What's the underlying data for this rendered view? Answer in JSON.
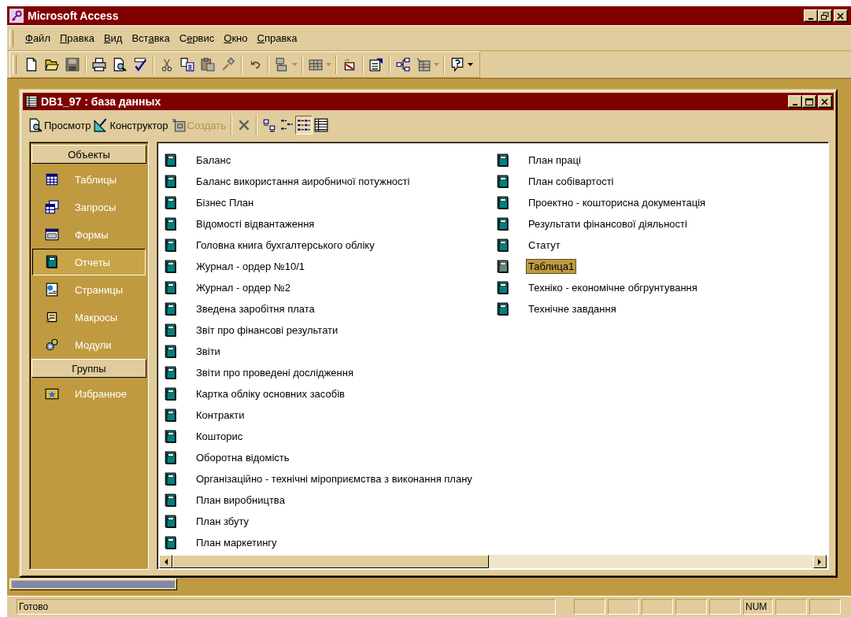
{
  "window": {
    "title": "Microsoft Access",
    "controls": [
      {
        "kind": "minimize"
      },
      {
        "kind": "restore"
      },
      {
        "kind": "close"
      }
    ]
  },
  "menu": [
    {
      "key": "Ф",
      "after": "айл"
    },
    {
      "key": "П",
      "after": "равка"
    },
    {
      "key": "В",
      "after": "ид"
    },
    {
      "before": "Вст",
      "key": "а",
      "after": "вка"
    },
    {
      "before": "С",
      "key": "е",
      "after": "рвис"
    },
    {
      "key": "О",
      "after": "кно"
    },
    {
      "key": "С",
      "after": "правка"
    }
  ],
  "toolbar": [
    {
      "kind": "new",
      "disabled": false
    },
    {
      "kind": "open",
      "disabled": false
    },
    {
      "kind": "save",
      "disabled": true
    },
    {
      "kind": "separator"
    },
    {
      "kind": "print",
      "disabled": false
    },
    {
      "kind": "preview",
      "disabled": false
    },
    {
      "kind": "spelling",
      "disabled": false
    },
    {
      "kind": "separator"
    },
    {
      "kind": "cut",
      "disabled": true
    },
    {
      "kind": "copy",
      "disabled": false
    },
    {
      "kind": "paste",
      "disabled": true
    },
    {
      "kind": "format_painter",
      "disabled": true
    },
    {
      "kind": "separator"
    },
    {
      "kind": "undo",
      "disabled": true
    },
    {
      "kind": "separator"
    },
    {
      "kind": "office_links",
      "disabled": true,
      "dropdown": true
    },
    {
      "kind": "separator"
    },
    {
      "kind": "analyze",
      "disabled": true,
      "dropdown": true
    },
    {
      "kind": "separator"
    },
    {
      "kind": "code",
      "disabled": false
    },
    {
      "kind": "separator"
    },
    {
      "kind": "properties",
      "disabled": false
    },
    {
      "kind": "separator"
    },
    {
      "kind": "relationships",
      "disabled": false
    },
    {
      "kind": "new_object",
      "disabled": true,
      "dropdown": true
    },
    {
      "kind": "separator"
    },
    {
      "kind": "help",
      "disabled": false,
      "dropdown": true
    }
  ],
  "database_window": {
    "title": "DB1_97 : база данных",
    "controls": [
      {
        "kind": "minimize"
      },
      {
        "kind": "maximize"
      },
      {
        "kind": "close"
      }
    ],
    "toolbar": [
      {
        "kind": "preview",
        "label": "Просмотр",
        "disabled": false
      },
      {
        "kind": "design",
        "label": "Конструктор",
        "disabled": false
      },
      {
        "kind": "create",
        "label": "Создать",
        "disabled": true
      },
      {
        "kind": "separator"
      },
      {
        "kind": "delete",
        "disabled": true
      },
      {
        "kind": "separator"
      },
      {
        "kind": "large_icons",
        "selected": false
      },
      {
        "kind": "small_icons",
        "selected": false
      },
      {
        "kind": "list",
        "selected": true
      },
      {
        "kind": "details",
        "selected": false
      }
    ],
    "sidebar": [
      {
        "header": "Объекты",
        "items": [
          {
            "kind": "tables",
            "label": "Таблицы",
            "selected": false
          },
          {
            "kind": "queries",
            "label": "Запросы",
            "selected": false
          },
          {
            "kind": "forms",
            "label": "Формы",
            "selected": false
          },
          {
            "kind": "reports",
            "label": "Отчеты",
            "selected": true
          },
          {
            "kind": "pages",
            "label": "Страницы",
            "selected": false
          },
          {
            "kind": "macros",
            "label": "Макросы",
            "selected": false
          },
          {
            "kind": "modules",
            "label": "Модули",
            "selected": false
          }
        ]
      },
      {
        "header": "Группы",
        "items": [
          {
            "kind": "favorites",
            "label": "Избранное",
            "selected": false
          }
        ]
      }
    ],
    "objects": {
      "columns": [
        {
          "items": [
            {
              "label": "Баланс",
              "selected": false
            },
            {
              "label": "Баланс використання аиробничої потужності",
              "selected": false
            },
            {
              "label": "Бізнес План",
              "selected": false
            },
            {
              "label": "Відомості відвантаження",
              "selected": false
            },
            {
              "label": "Головна книга бухгалтерського обліку",
              "selected": false
            },
            {
              "label": "Журнал - ордер №10/1",
              "selected": false
            },
            {
              "label": "Журнал - ордер №2",
              "selected": false
            },
            {
              "label": "Зведена заробітня плата",
              "selected": false
            },
            {
              "label": "Звіт про фінансові результати",
              "selected": false
            },
            {
              "label": "Звіти",
              "selected": false
            },
            {
              "label": "Звіти про проведені дослідження",
              "selected": false
            },
            {
              "label": "Картка обліку основних засобів",
              "selected": false
            },
            {
              "label": "Контракти",
              "selected": false
            },
            {
              "label": "Кошторис",
              "selected": false
            },
            {
              "label": "Оборотна відомість",
              "selected": false
            },
            {
              "label": "Організаційно - технічні міроприємства з виконання плану",
              "selected": false
            },
            {
              "label": "План виробництва",
              "selected": false
            },
            {
              "label": "План збуту",
              "selected": false
            },
            {
              "label": "План маркетингу",
              "selected": false
            }
          ]
        },
        {
          "items": [
            {
              "label": "План праці",
              "selected": false
            },
            {
              "label": "План собівартості",
              "selected": false
            },
            {
              "label": "Проектно - кошторисна документація",
              "selected": false
            },
            {
              "label": "Результати фінансової діяльності",
              "selected": false
            },
            {
              "label": "Статут",
              "selected": false
            },
            {
              "label": "Таблица1",
              "selected": true
            },
            {
              "label": "Техніко - економічне обгрунтування",
              "selected": false
            },
            {
              "label": "Технічне завдання",
              "selected": false
            }
          ]
        }
      ]
    }
  },
  "status_bar": {
    "text": "Готово",
    "indicators": [
      {
        "on": false
      },
      {
        "on": false
      },
      {
        "on": false
      },
      {
        "on": false
      },
      {
        "on": false
      },
      {
        "label": "NUM",
        "on": true
      },
      {
        "on": false
      },
      {
        "on": false
      }
    ]
  }
}
